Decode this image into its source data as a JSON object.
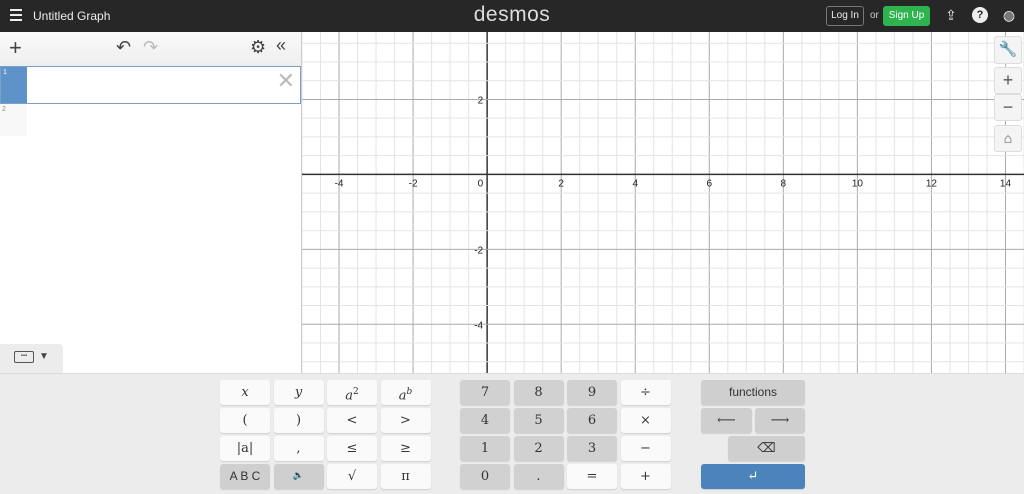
{
  "header": {
    "title": "Untitled Graph",
    "logo": "desmos",
    "login_label": "Log In",
    "or_label": "or",
    "signup_label": "Sign Up",
    "icons": [
      "menu-icon",
      "share-icon",
      "help-icon",
      "globe-icon"
    ],
    "help_glyph": "?"
  },
  "expression_list": {
    "toolbar": {
      "add": "+",
      "undo": "↶",
      "redo": "↷",
      "settings": "⚙",
      "collapse": "«"
    },
    "expressions": [
      {
        "index": "1",
        "value": ""
      },
      {
        "index": "2",
        "value": ""
      }
    ],
    "delete": "✕"
  },
  "graph": {
    "x_range": [
      -5,
      14.5
    ],
    "y_range": [
      -5.3,
      3.8
    ],
    "major_step": 2,
    "minor_step": 0.5,
    "x_ticks": [
      "-4",
      "-2",
      "0",
      "2",
      "4",
      "6",
      "8",
      "10",
      "12",
      "14"
    ],
    "y_ticks": [
      "2",
      "-2",
      "-4"
    ],
    "controls": {
      "settings": "wrench-icon",
      "zoom_in": "+",
      "zoom_out": "−",
      "home": "home-icon"
    }
  },
  "keypad": {
    "left": [
      [
        "x",
        "y",
        "a2",
        "ab"
      ],
      [
        "(",
        ")",
        "<",
        ">"
      ],
      [
        "|a|",
        ",",
        "≤",
        "≥"
      ],
      [
        "A B C",
        "🔈",
        "√",
        "π"
      ]
    ],
    "numbers": [
      [
        "7",
        "8",
        "9",
        "÷"
      ],
      [
        "4",
        "5",
        "6",
        "×"
      ],
      [
        "1",
        "2",
        "3",
        "−"
      ],
      [
        "0",
        ".",
        "=",
        "+"
      ]
    ],
    "functions_label": "functions",
    "left_arrow": "⟵",
    "right_arrow": "⟶",
    "backspace": "⌫",
    "enter": "↵"
  },
  "colors": {
    "accent": "#5d93c8",
    "signup": "#2fb34f",
    "enter": "#4b84ba"
  }
}
